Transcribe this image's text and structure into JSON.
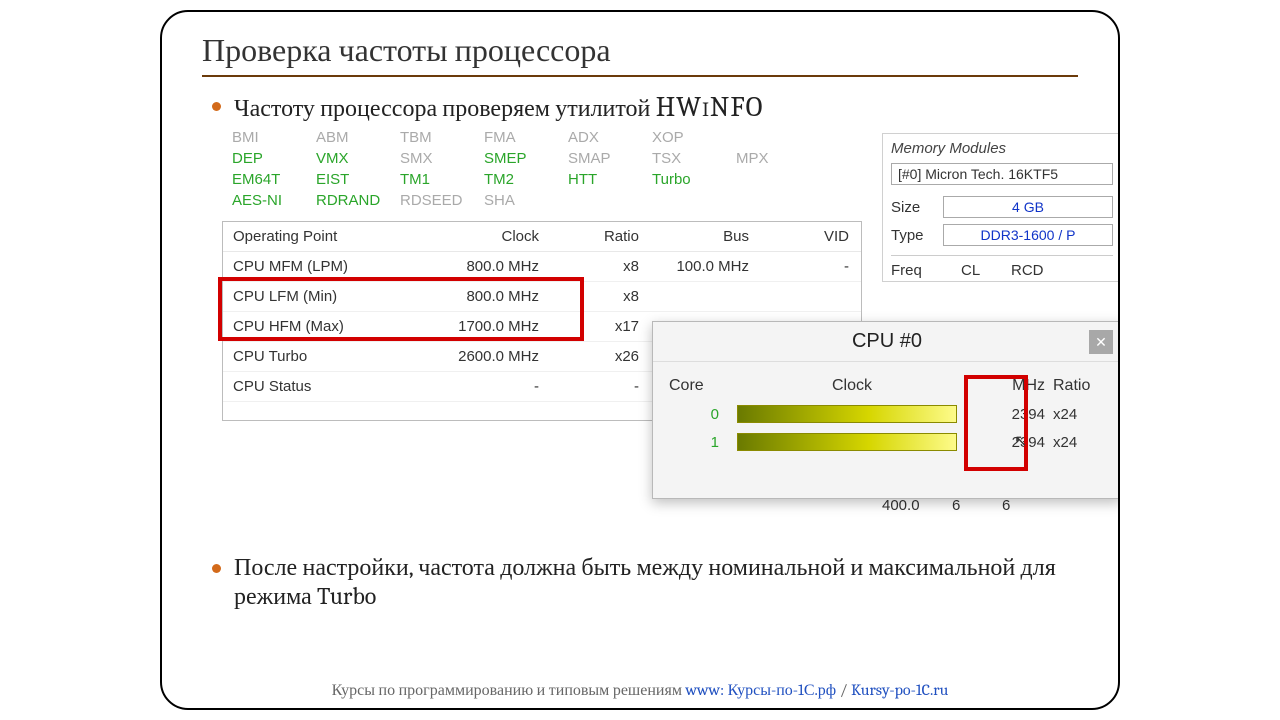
{
  "slide": {
    "title": "Проверка частоты процессора",
    "bullet1_prefix": "Частоту процессора проверяем утилитой ",
    "bullet1_hw": "HWiNFO",
    "bullet2": "После настройки, частота должна быть между номинальной и максимальной для режима Turbo",
    "footer_text": "Курсы по программированию и типовым решениям   ",
    "footer_www": "www:  ",
    "footer_link1": "Курсы-по-1С.рф",
    "footer_sep": "  /  ",
    "footer_link2": "Kursy-po-1C.ru"
  },
  "features": {
    "grid": [
      [
        "BMI",
        "ABM",
        "TBM",
        "FMA",
        "ADX",
        "XOP",
        ""
      ],
      [
        "DEP",
        "VMX",
        "SMX",
        "SMEP",
        "SMAP",
        "TSX",
        "MPX"
      ],
      [
        "EM64T",
        "EIST",
        "TM1",
        "TM2",
        "HTT",
        "Turbo",
        ""
      ],
      [
        "AES-NI",
        "RDRAND",
        "RDSEED",
        "SHA",
        "",
        "",
        ""
      ]
    ],
    "on": [
      "DEP",
      "VMX",
      "SMEP",
      "EM64T",
      "EIST",
      "TM1",
      "TM2",
      "HTT",
      "Turbo",
      "AES-NI",
      "RDRAND"
    ]
  },
  "op_table": {
    "headers": [
      "Operating Point",
      "Clock",
      "Ratio",
      "Bus",
      "VID"
    ],
    "rows": [
      {
        "name": "CPU MFM (LPM)",
        "clock": "800.0 MHz",
        "ratio": "x8",
        "bus": "100.0 MHz",
        "vid": "-"
      },
      {
        "name": "CPU LFM (Min)",
        "clock": "800.0 MHz",
        "ratio": "x8",
        "bus": "",
        "vid": ""
      },
      {
        "name": "CPU HFM (Max)",
        "clock": "1700.0 MHz",
        "ratio": "x17",
        "bus": "",
        "vid": ""
      },
      {
        "name": "CPU Turbo",
        "clock": "2600.0 MHz",
        "ratio": "x26",
        "bus": "",
        "vid": ""
      },
      {
        "name": "CPU Status",
        "clock": "-",
        "ratio": "-",
        "bus": "",
        "vid": ""
      }
    ]
  },
  "memory": {
    "title": "Memory Modules",
    "combo": "[#0] Micron Tech. 16KTF5",
    "size_label": "Size",
    "size": "4 GB",
    "type_label": "Type",
    "type": "DDR3-1600 / P",
    "cols": [
      "Freq",
      "CL",
      "RCD",
      ""
    ],
    "foot": [
      "400.0",
      "6",
      "6"
    ]
  },
  "cpu_popup": {
    "title": "CPU #0",
    "headers": [
      "Core",
      "Clock",
      "MHz",
      "Ratio"
    ],
    "rows": [
      {
        "core": "0",
        "mhz": "2394",
        "ratio": "x24"
      },
      {
        "core": "1",
        "mhz": "2394",
        "ratio": "x24"
      }
    ]
  }
}
